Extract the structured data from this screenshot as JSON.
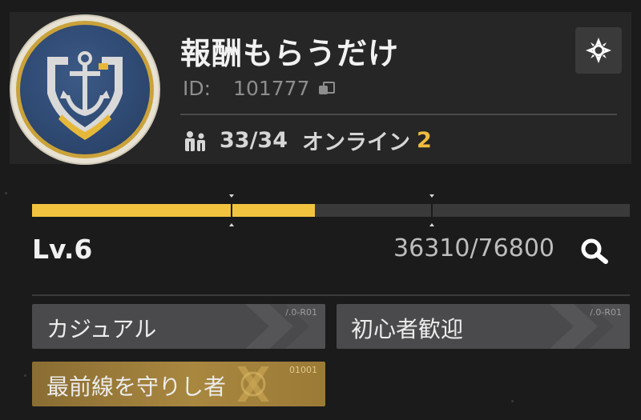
{
  "guild": {
    "name": "報酬もらうだけ",
    "id_label": "ID:",
    "id_value": "101777",
    "members": "33/34",
    "online_label": "オンライン",
    "online_count": "2"
  },
  "level": {
    "label": "Lv.6",
    "exp": "36310/76800",
    "progress_fraction": 0.4728
  },
  "tags": [
    {
      "label": "カジュアル",
      "code": "/.0-R01"
    },
    {
      "label": "初心者歓迎",
      "code": "/.0-R01"
    },
    {
      "label": "最前線を守りし者",
      "code": "01001"
    }
  ],
  "colors": {
    "accent": "#f1c33e",
    "panel": "#262627",
    "tag": "#4a4a4c",
    "gold_tag": "#a8873f"
  },
  "icons": [
    "anchor-emblem",
    "people-icon",
    "copy-icon",
    "settings-icon",
    "search-icon"
  ]
}
